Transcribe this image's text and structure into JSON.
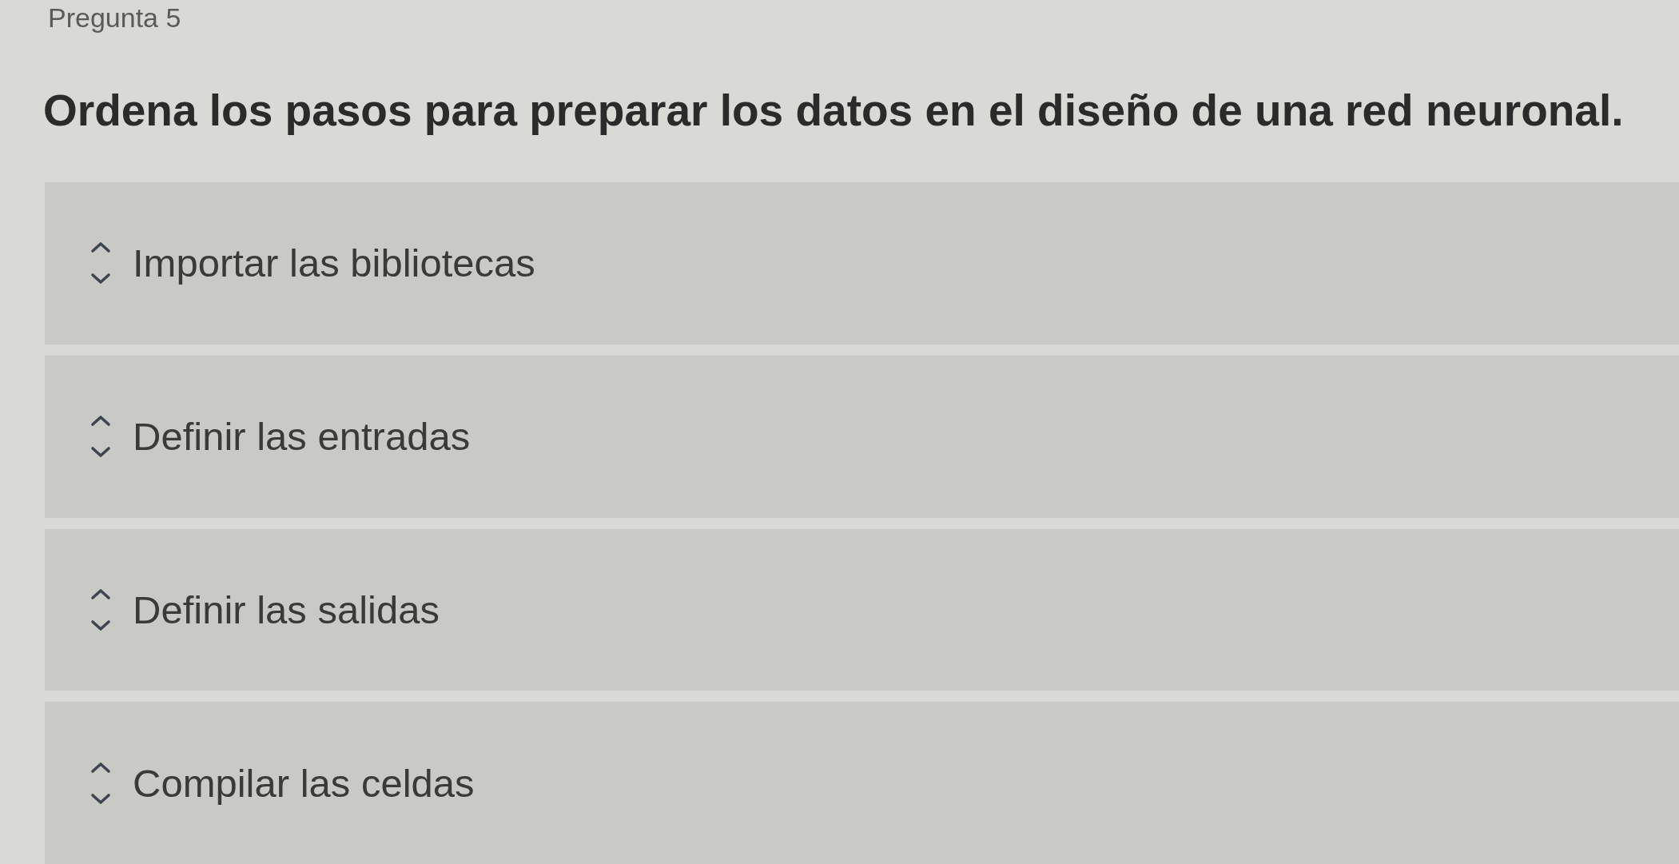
{
  "question_number": "Pregunta 5",
  "question": "Ordena los pasos para preparar los datos en el diseño de una red neuronal.",
  "steps": [
    {
      "label": "Importar las bibliotecas"
    },
    {
      "label": "Definir las entradas"
    },
    {
      "label": "Definir las salidas"
    },
    {
      "label": "Compilar las celdas"
    }
  ]
}
